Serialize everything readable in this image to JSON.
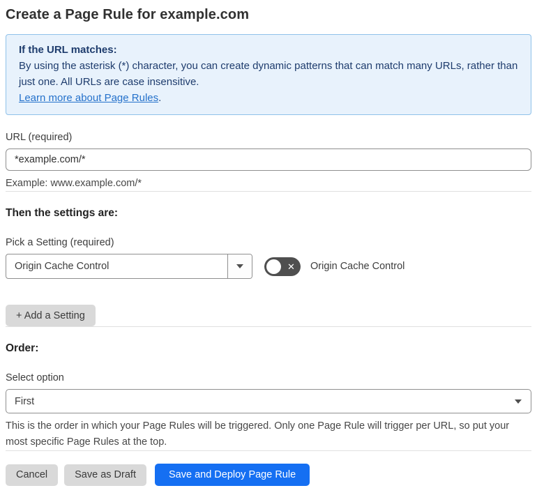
{
  "page": {
    "title": "Create a Page Rule for example.com"
  },
  "info_box": {
    "heading": "If the URL matches:",
    "body": "By using the asterisk (*) character, you can create dynamic patterns that can match many URLs, rather than just one. All URLs are case insensitive.",
    "link_label": "Learn more about Page Rules",
    "link_suffix": "."
  },
  "url_field": {
    "label": "URL (required)",
    "value": "*example.com/*",
    "helper": "Example: www.example.com/*"
  },
  "settings_section": {
    "heading": "Then the settings are:",
    "picker_label": "Pick a Setting (required)",
    "picker_value": "Origin Cache Control",
    "toggle_label": "Origin Cache Control",
    "toggle_state": "off",
    "toggle_glyph": "✕",
    "add_setting_label": "+ Add a Setting"
  },
  "order_section": {
    "heading": "Order:",
    "select_label": "Select option",
    "select_value": "First",
    "helper": "This is the order in which your Page Rules will be triggered. Only one Page Rule will trigger per URL, so put your most specific Page Rules at the top."
  },
  "footer": {
    "cancel_label": "Cancel",
    "save_draft_label": "Save as Draft",
    "save_deploy_label": "Save and Deploy Page Rule"
  },
  "colors": {
    "accent_blue": "#156ff2",
    "info_background": "#e8f2fc",
    "info_border": "#8fc1ea",
    "info_text": "#1e3c6d",
    "link_blue": "#2471cb",
    "toggle_off_gray": "#4f4f4f",
    "button_gray": "#d9d9d9"
  }
}
